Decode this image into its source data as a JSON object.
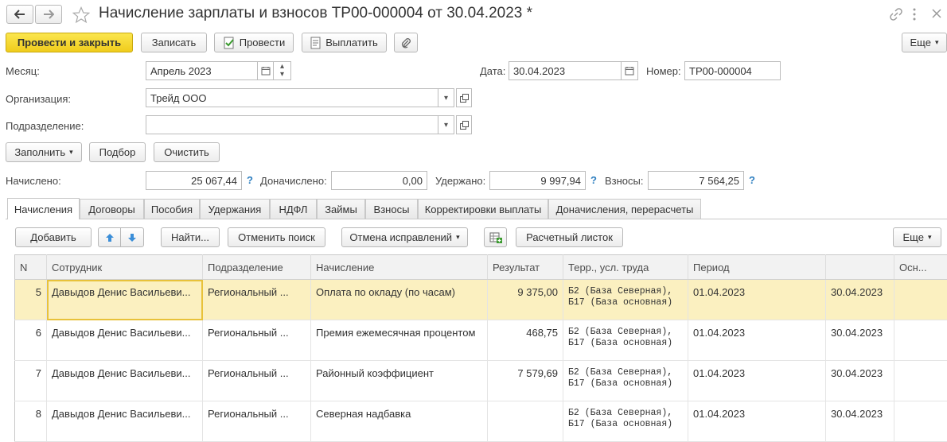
{
  "window": {
    "title": "Начисление зарплаты и взносов ТР00-000004 от 30.04.2023 *",
    "nav_back_icon": "arrow-left-icon",
    "nav_forward_icon": "arrow-right-icon",
    "favorite_icon": "star-icon"
  },
  "toolbar": {
    "post_close_label": "Провести и закрыть",
    "save_label": "Записать",
    "post_label": "Провести",
    "pay_label": "Выплатить",
    "more_label": "Еще"
  },
  "form": {
    "month_label": "Месяц:",
    "month_value": "Апрель 2023",
    "date_label": "Дата:",
    "date_value": "30.04.2023",
    "number_label": "Номер:",
    "number_value": "ТР00-000004",
    "org_label": "Организация:",
    "org_value": "Трейд ООО",
    "dept_label": "Подразделение:",
    "dept_value": ""
  },
  "actions": {
    "fill_label": "Заполнить",
    "pick_label": "Подбор",
    "clear_label": "Очистить"
  },
  "totals": {
    "accrued_label": "Начислено:",
    "accrued_value": "25 067,44",
    "extra_label": "Доначислено:",
    "extra_value": "0,00",
    "withheld_label": "Удержано:",
    "withheld_value": "9 997,94",
    "contrib_label": "Взносы:",
    "contrib_value": "7 564,25",
    "help_mark": "?"
  },
  "tabs": [
    "Начисления",
    "Договоры",
    "Пособия",
    "Удержания",
    "НДФЛ",
    "Займы",
    "Взносы",
    "Корректировки выплаты",
    "Доначисления, перерасчеты"
  ],
  "grid_toolbar": {
    "add_label": "Добавить",
    "find_label": "Найти...",
    "cancel_search_label": "Отменить поиск",
    "cancel_fix_label": "Отмена исправлений",
    "payslip_label": "Расчетный листок",
    "more_label": "Еще"
  },
  "grid": {
    "headers": [
      "N",
      "Сотрудник",
      "Подразделение",
      "Начисление",
      "Результат",
      "Терр., усл. труда",
      "Период",
      "",
      "Осн..."
    ],
    "rows": [
      {
        "n": "5",
        "employee": "Давыдов Денис Васильеви...",
        "dept": "Региональный ...",
        "accrual": "Оплата по окладу (по часам)",
        "result": "9 375,00",
        "terr1": "Б2 (База Северная),",
        "terr2": "Б17 (База основная)",
        "from": "01.04.2023",
        "to": "30.04.2023"
      },
      {
        "n": "6",
        "employee": "Давыдов Денис Васильеви...",
        "dept": "Региональный ...",
        "accrual": "Премия ежемесячная процентом",
        "result": "468,75",
        "terr1": "Б2 (База Северная),",
        "terr2": "Б17 (База основная)",
        "from": "01.04.2023",
        "to": "30.04.2023"
      },
      {
        "n": "7",
        "employee": "Давыдов Денис Васильеви...",
        "dept": "Региональный ...",
        "accrual": "Районный коэффициент",
        "result": "7 579,69",
        "terr1": "Б2 (База Северная),",
        "terr2": "Б17 (База основная)",
        "from": "01.04.2023",
        "to": "30.04.2023"
      },
      {
        "n": "8",
        "employee": "Давыдов Денис Васильеви...",
        "dept": "Региональный ...",
        "accrual": "Северная надбавка",
        "result": "",
        "terr1": "Б2 (База Северная),",
        "terr2": "Б17 (База основная)",
        "from": "01.04.2023",
        "to": "30.04.2023"
      }
    ]
  },
  "colors": {
    "accent_yellow": "#f5d32a",
    "selected_row": "#fbf0c0",
    "help_blue": "#2e7fc0"
  }
}
